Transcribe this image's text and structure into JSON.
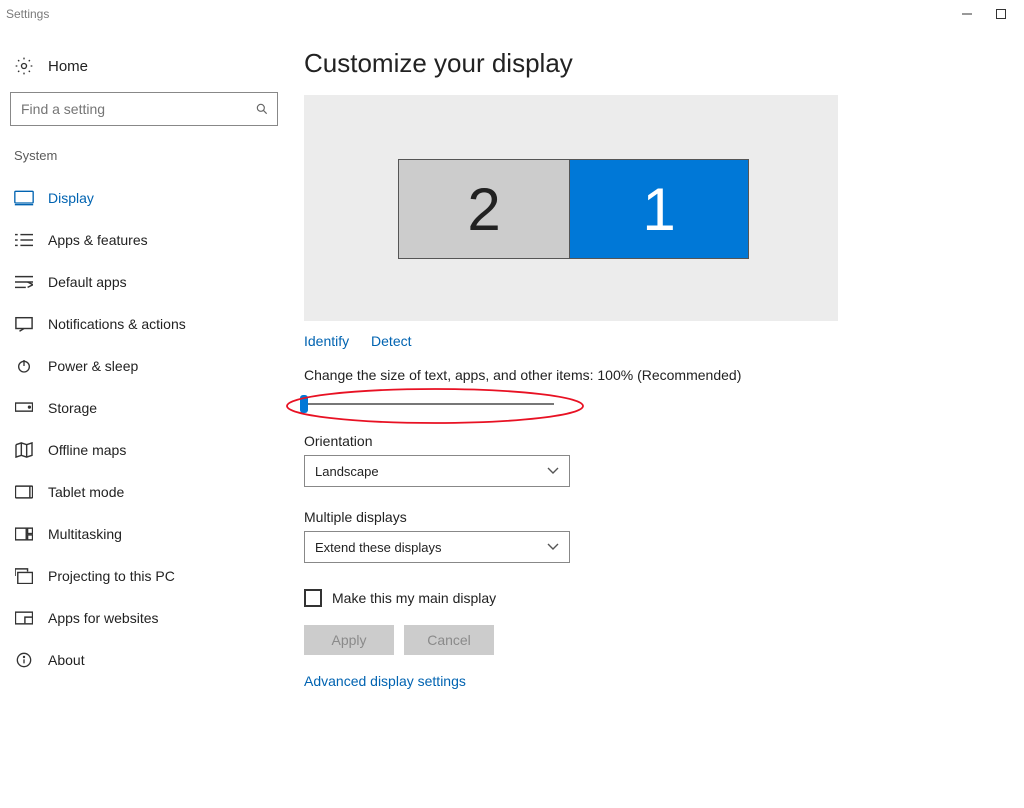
{
  "window": {
    "title": "Settings"
  },
  "header": {
    "home": "Home"
  },
  "search": {
    "placeholder": "Find a setting"
  },
  "section_label": "System",
  "nav": [
    {
      "key": "display",
      "label": "Display"
    },
    {
      "key": "apps-features",
      "label": "Apps & features"
    },
    {
      "key": "default-apps",
      "label": "Default apps"
    },
    {
      "key": "notifications",
      "label": "Notifications & actions"
    },
    {
      "key": "power-sleep",
      "label": "Power & sleep"
    },
    {
      "key": "storage",
      "label": "Storage"
    },
    {
      "key": "offline-maps",
      "label": "Offline maps"
    },
    {
      "key": "tablet-mode",
      "label": "Tablet mode"
    },
    {
      "key": "multitasking",
      "label": "Multitasking"
    },
    {
      "key": "projecting",
      "label": "Projecting to this PC"
    },
    {
      "key": "apps-websites",
      "label": "Apps for websites"
    },
    {
      "key": "about",
      "label": "About"
    }
  ],
  "main": {
    "title": "Customize your display",
    "monitors": {
      "left_num": "2",
      "right_num": "1"
    },
    "links": {
      "identify": "Identify",
      "detect": "Detect"
    },
    "scale_label": "Change the size of text, apps, and other items: 100% (Recommended)",
    "orientation_label": "Orientation",
    "orientation_value": "Landscape",
    "multi_label": "Multiple displays",
    "multi_value": "Extend these displays",
    "main_display_checkbox": "Make this my main display",
    "apply_label": "Apply",
    "cancel_label": "Cancel",
    "advanced": "Advanced display settings"
  }
}
